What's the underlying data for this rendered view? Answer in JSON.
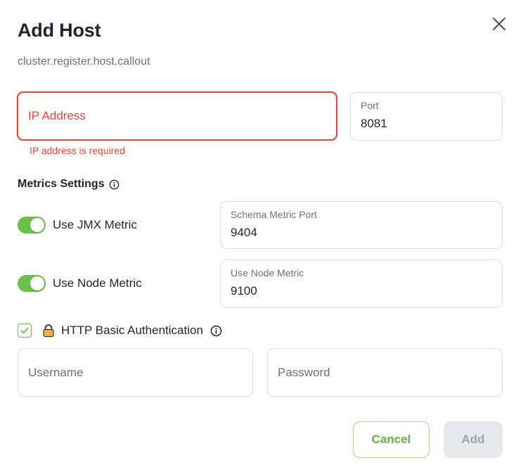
{
  "dialog": {
    "title": "Add Host",
    "subtitle": "cluster.register.host.callout",
    "close_icon": "close-icon"
  },
  "host": {
    "ip_placeholder": "IP Address",
    "ip_error": "IP address is required",
    "port_label": "Port",
    "port_value": "8081"
  },
  "metrics": {
    "section_title": "Metrics Settings",
    "jmx": {
      "toggle_label": "Use JMX Metric",
      "enabled": true,
      "port_label": "Schema Metric Port",
      "port_value": "9404"
    },
    "node": {
      "toggle_label": "Use Node Metric",
      "enabled": true,
      "port_label": "Use Node Metric",
      "port_value": "9100"
    }
  },
  "auth": {
    "checked": true,
    "label": "HTTP Basic Authentication",
    "username_placeholder": "Username",
    "password_placeholder": "Password"
  },
  "actions": {
    "cancel_label": "Cancel",
    "add_label": "Add"
  },
  "colors": {
    "accent_green": "#6ac04b",
    "error_red": "#e5483a",
    "disabled_bg": "#e6e8eb"
  }
}
